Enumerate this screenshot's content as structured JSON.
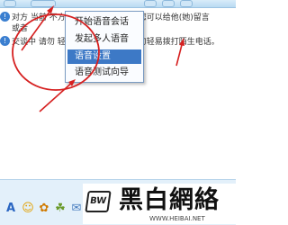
{
  "messages": [
    {
      "icon": "info-icon",
      "text": "对方 当前 不方便，可能无法回复，您可以给他(她)留言"
    },
    {
      "icon": "",
      "text": "或者"
    },
    {
      "icon": "info-icon",
      "text": "交谈中 请勿 轻信汇款、中奖信息，勿轻易拨打陌生电话。"
    }
  ],
  "voice_menu": {
    "items": [
      {
        "label": "开始语音会话",
        "selected": false
      },
      {
        "label": "发起多人语音",
        "selected": false
      },
      {
        "label": "语音设置",
        "selected": true
      },
      {
        "label": "语音测试向导",
        "selected": false
      }
    ]
  },
  "input_toolbar": {
    "icons": [
      "font-icon",
      "emoji-icon",
      "magic-expression-icon",
      "shake-icon",
      "voice-message-icon"
    ],
    "font_glyph": "A"
  },
  "watermark": {
    "logo_text": "BW",
    "title": "黑白網絡",
    "url": "WWW.HEIBAI.NET"
  },
  "colors": {
    "menu_highlight": "#3d79c6",
    "annotation_red": "#d62020",
    "info_icon_blue": "#3b7fd0"
  }
}
